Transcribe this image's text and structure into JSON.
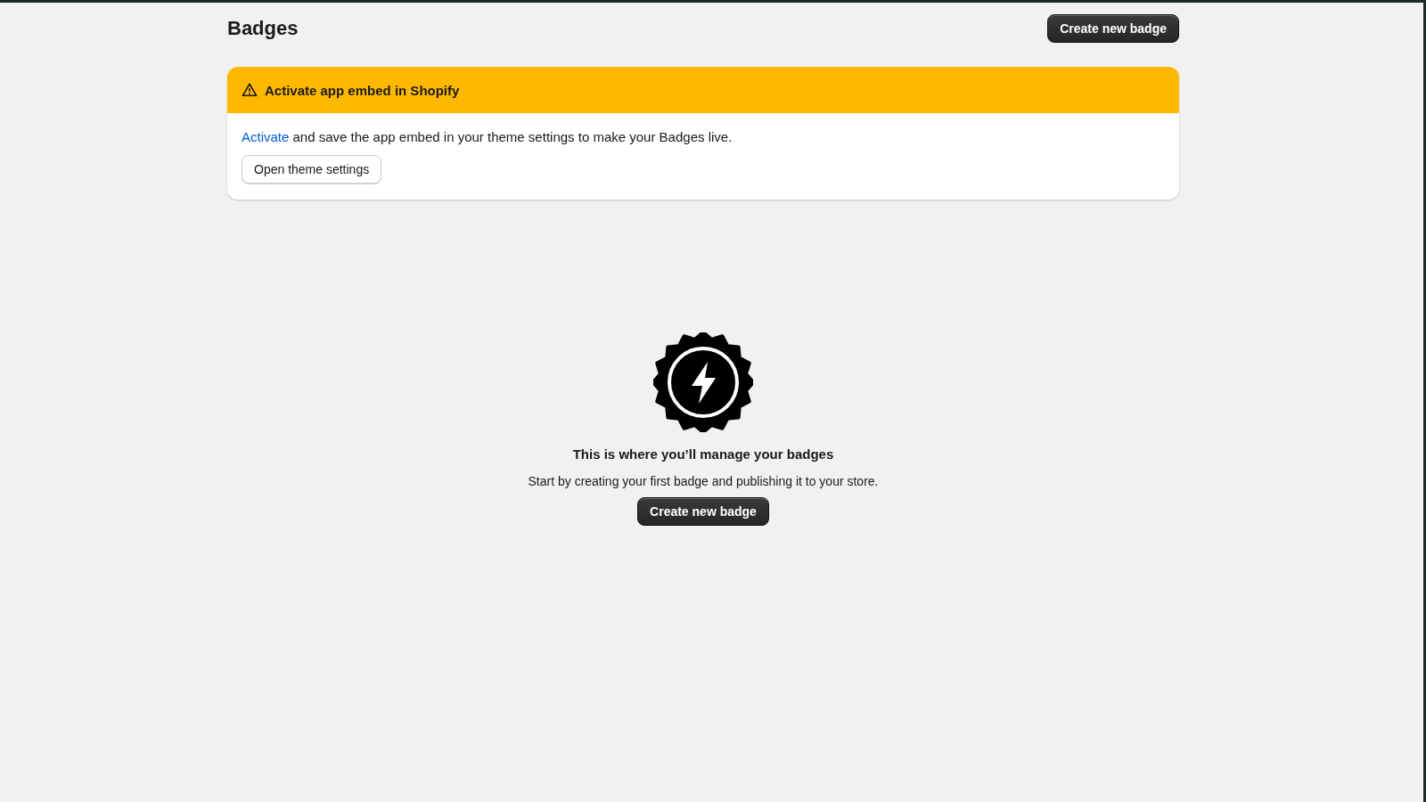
{
  "page": {
    "title": "Badges",
    "primary_action": "Create new badge"
  },
  "banner": {
    "kind": "warning",
    "title": "Activate app embed in Shopify",
    "link": "Activate",
    "text": " and save the app embed in your theme settings to make your Badges live.",
    "button": "Open theme settings"
  },
  "empty_state": {
    "heading": "This is where you’ll manage your badges",
    "text": "Start by creating your first badge and publishing it to your store.",
    "button": "Create new badge"
  }
}
